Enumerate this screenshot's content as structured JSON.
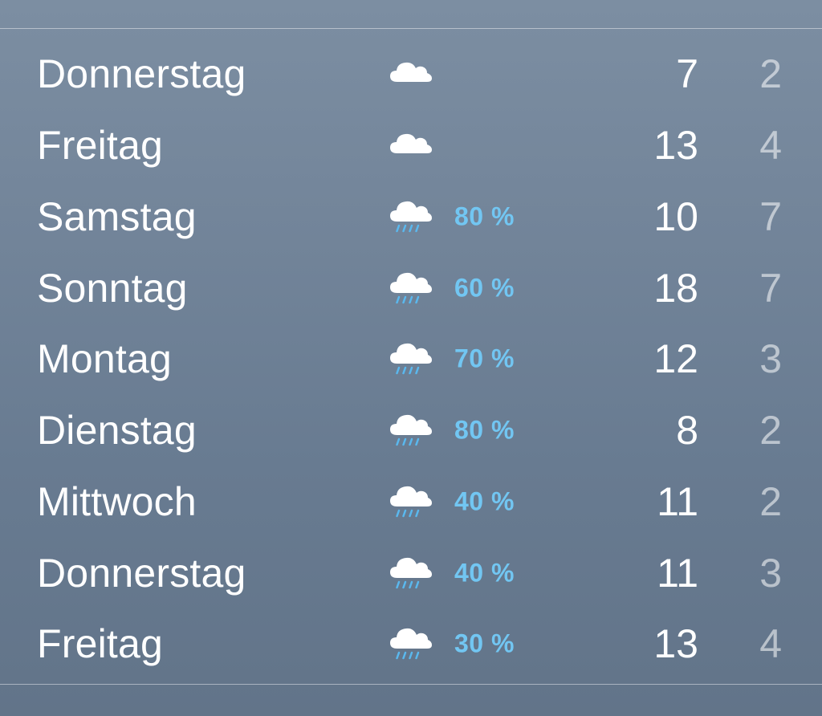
{
  "forecast": {
    "days": [
      {
        "day": "Donnerstag",
        "icon": "cloud-icon",
        "precip": "",
        "high": "7",
        "low": "2"
      },
      {
        "day": "Freitag",
        "icon": "cloud-icon",
        "precip": "",
        "high": "13",
        "low": "4"
      },
      {
        "day": "Samstag",
        "icon": "rain-cloud-icon",
        "precip": "80 %",
        "high": "10",
        "low": "7"
      },
      {
        "day": "Sonntag",
        "icon": "rain-cloud-icon",
        "precip": "60 %",
        "high": "18",
        "low": "7"
      },
      {
        "day": "Montag",
        "icon": "rain-cloud-icon",
        "precip": "70 %",
        "high": "12",
        "low": "3"
      },
      {
        "day": "Dienstag",
        "icon": "rain-cloud-icon",
        "precip": "80 %",
        "high": "8",
        "low": "2"
      },
      {
        "day": "Mittwoch",
        "icon": "rain-cloud-icon",
        "precip": "40 %",
        "high": "11",
        "low": "2"
      },
      {
        "day": "Donnerstag",
        "icon": "rain-cloud-icon",
        "precip": "40 %",
        "high": "11",
        "low": "3"
      },
      {
        "day": "Freitag",
        "icon": "rain-cloud-icon",
        "precip": "30 %",
        "high": "13",
        "low": "4"
      }
    ]
  },
  "colors": {
    "precip_text": "#72c6f2",
    "rain_drops": "#5ab8ee",
    "primary_text": "#ffffff"
  }
}
